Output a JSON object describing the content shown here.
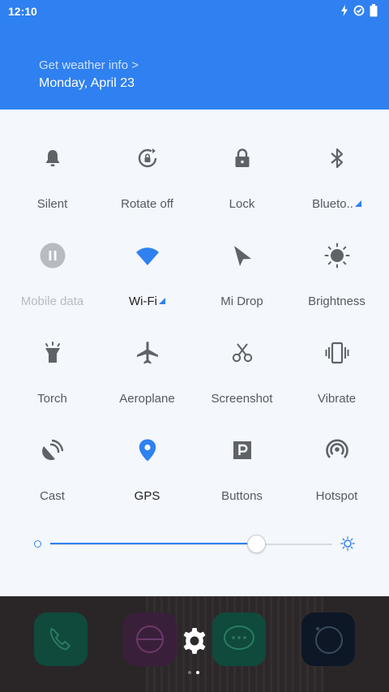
{
  "status_bar": {
    "time": "12:10",
    "icons": [
      "charging-icon",
      "sync-check-icon",
      "battery-icon"
    ]
  },
  "header": {
    "weather_link": "Get weather info >",
    "date": "Monday, April 23"
  },
  "tiles": [
    {
      "label": "Silent",
      "icon": "bell-icon",
      "state": "off"
    },
    {
      "label": "Rotate off",
      "icon": "rotate-lock-icon",
      "state": "off"
    },
    {
      "label": "Lock",
      "icon": "padlock-icon",
      "state": "off"
    },
    {
      "label": "Blueto..",
      "icon": "bluetooth-icon",
      "state": "off",
      "has_menu": true
    },
    {
      "label": "Mobile data",
      "icon": "pause-circle-icon",
      "state": "disabled"
    },
    {
      "label": "Wi-Fi",
      "icon": "wifi-icon",
      "state": "on",
      "has_menu": true
    },
    {
      "label": "Mi Drop",
      "icon": "send-arrow-icon",
      "state": "off"
    },
    {
      "label": "Brightness",
      "icon": "sun-icon",
      "state": "off"
    },
    {
      "label": "Torch",
      "icon": "torch-icon",
      "state": "off"
    },
    {
      "label": "Aeroplane",
      "icon": "airplane-icon",
      "state": "off"
    },
    {
      "label": "Screenshot",
      "icon": "scissors-icon",
      "state": "off"
    },
    {
      "label": "Vibrate",
      "icon": "vibrate-icon",
      "state": "off"
    },
    {
      "label": "Cast",
      "icon": "cast-icon",
      "state": "off"
    },
    {
      "label": "GPS",
      "icon": "location-pin-icon",
      "state": "on"
    },
    {
      "label": "Buttons",
      "icon": "p-box-icon",
      "state": "off"
    },
    {
      "label": "Hotspot",
      "icon": "hotspot-icon",
      "state": "off"
    }
  ],
  "brightness": {
    "level_fraction": 0.73
  },
  "home_screen": {
    "page_count": 2,
    "active_page": 2
  },
  "colors": {
    "accent": "#2f80f0",
    "icon_off": "#5f6368",
    "disabled": "#b7bcc3"
  }
}
